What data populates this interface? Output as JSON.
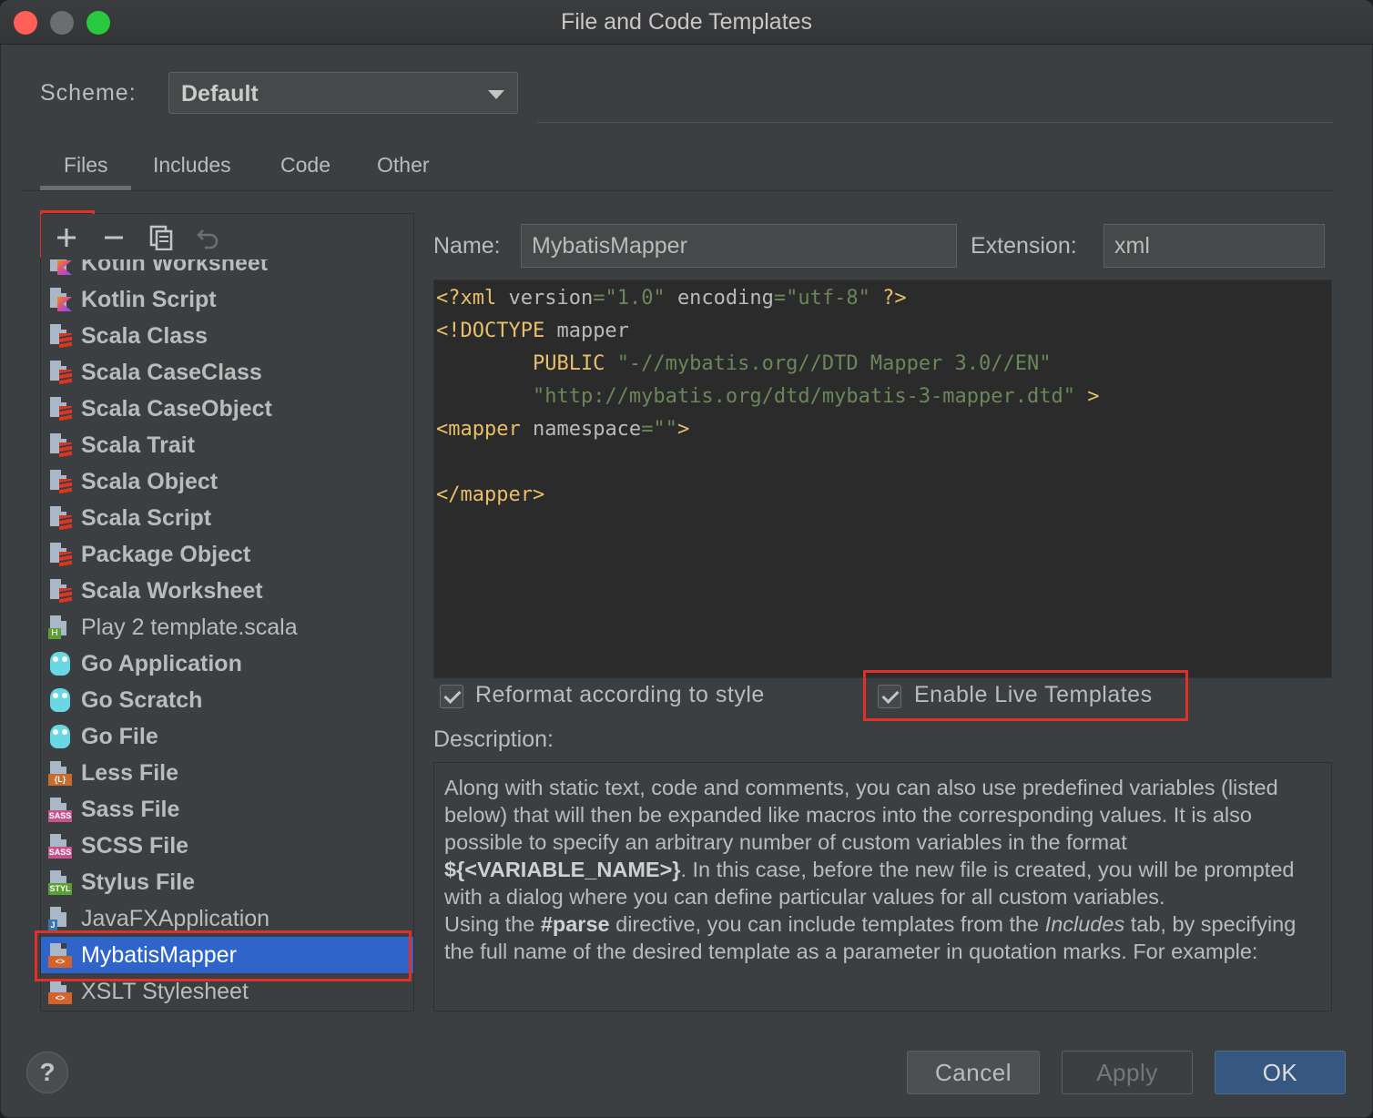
{
  "window": {
    "title": "File and Code Templates"
  },
  "scheme": {
    "label": "Scheme:",
    "value": "Default"
  },
  "tabs": [
    {
      "label": "Files",
      "active": true
    },
    {
      "label": "Includes"
    },
    {
      "label": "Code"
    },
    {
      "label": "Other"
    }
  ],
  "toolbar": {
    "add": "+",
    "remove": "−"
  },
  "templates": [
    {
      "label": "Kotlin Worksheet",
      "icon": "kotlin-file-icon",
      "bold": true
    },
    {
      "label": "Kotlin Script",
      "icon": "kotlin-file-icon",
      "bold": true
    },
    {
      "label": "Scala Class",
      "icon": "scala-file-icon",
      "bold": true
    },
    {
      "label": "Scala CaseClass",
      "icon": "scala-file-icon",
      "bold": true
    },
    {
      "label": "Scala CaseObject",
      "icon": "scala-file-icon",
      "bold": true
    },
    {
      "label": "Scala Trait",
      "icon": "scala-file-icon",
      "bold": true
    },
    {
      "label": "Scala Object",
      "icon": "scala-file-icon",
      "bold": true
    },
    {
      "label": "Scala Script",
      "icon": "scala-file-icon",
      "bold": true
    },
    {
      "label": "Package Object",
      "icon": "scala-file-icon",
      "bold": true
    },
    {
      "label": "Scala Worksheet",
      "icon": "scala-file-icon",
      "bold": true
    },
    {
      "label": "Play 2 template.scala",
      "icon": "html-file-icon",
      "bold": false
    },
    {
      "label": "Go Application",
      "icon": "go-gopher-icon",
      "bold": true
    },
    {
      "label": "Go Scratch",
      "icon": "go-gopher-icon",
      "bold": true
    },
    {
      "label": "Go File",
      "icon": "go-gopher-icon",
      "bold": true
    },
    {
      "label": "Less File",
      "icon": "less-file-icon",
      "bold": true
    },
    {
      "label": "Sass File",
      "icon": "sass-file-icon",
      "bold": true
    },
    {
      "label": "SCSS File",
      "icon": "sass-file-icon",
      "bold": true
    },
    {
      "label": "Stylus File",
      "icon": "stylus-file-icon",
      "bold": true
    },
    {
      "label": "JavaFXApplication",
      "icon": "java-file-icon",
      "bold": false
    },
    {
      "label": "MybatisMapper",
      "icon": "xml-file-icon",
      "bold": false,
      "selected": true
    },
    {
      "label": "XSLT Stylesheet",
      "icon": "xml-file-icon",
      "bold": false
    }
  ],
  "badges": {
    "html": "H",
    "less": "{L}",
    "sass": "SASS",
    "stylus": "STYL",
    "java": "J",
    "xml": "<>"
  },
  "form": {
    "name_label": "Name:",
    "name_value": "MybatisMapper",
    "extension_label": "Extension:",
    "extension_value": "xml"
  },
  "code": {
    "l1_a": "<?xml ",
    "l1_b": "version",
    "l1_c": "=",
    "l1_d": "\"1.0\"",
    "l1_e": " ",
    "l1_f": "encoding",
    "l1_g": "=",
    "l1_h": "\"utf-8\"",
    "l1_i": " ?>",
    "l2_a": "<!DOCTYPE ",
    "l2_b": "mapper",
    "l3_a": "        PUBLIC ",
    "l3_b": "\"-//mybatis.org//DTD Mapper 3.0//EN\"",
    "l4_a": "        ",
    "l4_b": "\"http://mybatis.org/dtd/mybatis-3-mapper.dtd\"",
    "l4_c": " >",
    "l5_a": "<mapper ",
    "l5_b": "namespace",
    "l5_c": "=",
    "l5_d": "\"\"",
    "l5_e": ">",
    "l7_a": "</mapper>"
  },
  "options": {
    "reformat_label": "Reformat according to style",
    "reformat_checked": true,
    "live_templates_label": "Enable Live Templates",
    "live_templates_checked": true
  },
  "description": {
    "label": "Description:",
    "p1": "Along with static text, code and comments, you can also use predefined variables (listed below) that will then be expanded like macros into the corresponding values. It is also possible to specify an arbitrary number of custom variables in the format ",
    "p1_var": "${<VARIABLE_NAME>}",
    "p1_rest": ". In this case, before the new file is created, you will be prompted with a dialog where you can define particular values for all custom variables.",
    "p2_a": "Using the ",
    "p2_kw": "#parse",
    "p2_b": " directive, you can include templates from the ",
    "p2_em": "Includes",
    "p2_c": " tab, by specifying the full name of the desired template as a parameter in quotation marks. For example:"
  },
  "buttons": {
    "help": "?",
    "cancel": "Cancel",
    "apply": "Apply",
    "ok": "OK"
  }
}
